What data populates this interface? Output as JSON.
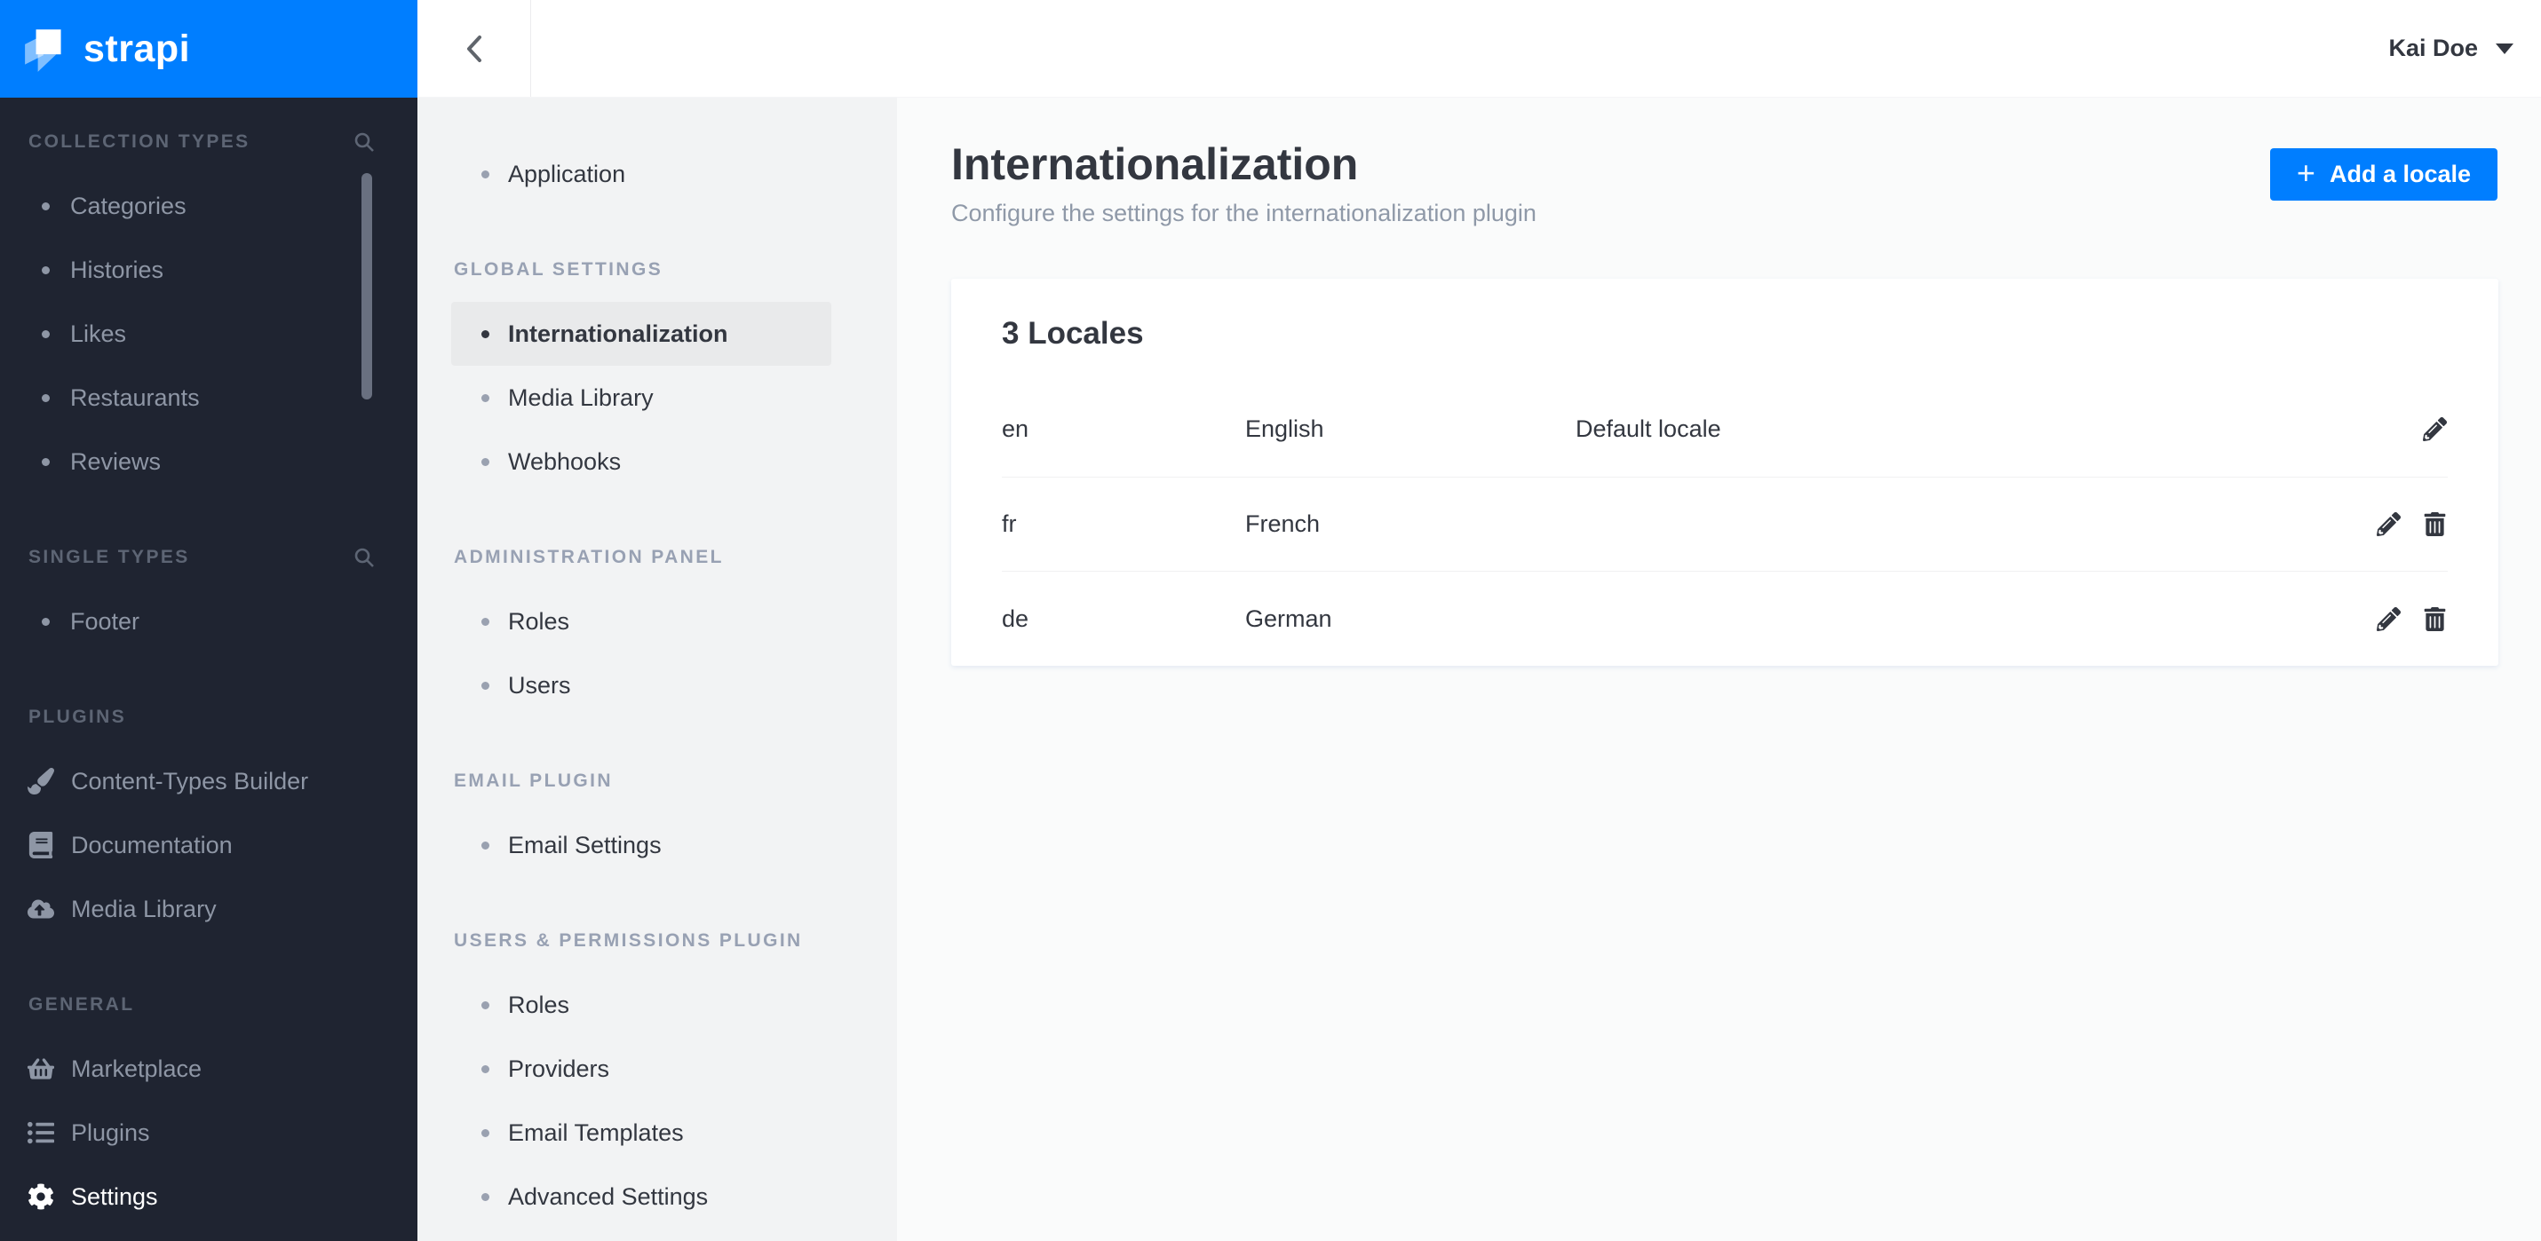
{
  "brand": {
    "name": "strapi",
    "header_color": "#007eff"
  },
  "topbar": {
    "back_icon": "chevron-left-icon",
    "user": {
      "name": "Kai Doe",
      "menu_icon": "caret-down-icon"
    }
  },
  "sidebar": {
    "sections": [
      {
        "title": "COLLECTION TYPES",
        "search_icon": "search-icon",
        "items": [
          {
            "label": "Categories",
            "icon": "bullet-dot"
          },
          {
            "label": "Histories",
            "icon": "bullet-dot"
          },
          {
            "label": "Likes",
            "icon": "bullet-dot"
          },
          {
            "label": "Restaurants",
            "icon": "bullet-dot"
          },
          {
            "label": "Reviews",
            "icon": "bullet-dot"
          }
        ]
      },
      {
        "title": "SINGLE TYPES",
        "search_icon": "search-icon",
        "items": [
          {
            "label": "Footer",
            "icon": "bullet-dot"
          }
        ]
      },
      {
        "title": "PLUGINS",
        "items": [
          {
            "label": "Content-Types Builder",
            "icon": "paint-brush-icon"
          },
          {
            "label": "Documentation",
            "icon": "book-icon"
          },
          {
            "label": "Media Library",
            "icon": "cloud-upload-icon"
          }
        ]
      },
      {
        "title": "GENERAL",
        "items": [
          {
            "label": "Marketplace",
            "icon": "shopping-basket-icon"
          },
          {
            "label": "Plugins",
            "icon": "list-icon"
          },
          {
            "label": "Settings",
            "icon": "gear-icon",
            "active": true
          }
        ]
      }
    ]
  },
  "settings_nav": {
    "top_item": {
      "label": "Application"
    },
    "sections": [
      {
        "title": "GLOBAL SETTINGS",
        "items": [
          {
            "label": "Internationalization",
            "active": true
          },
          {
            "label": "Media Library"
          },
          {
            "label": "Webhooks"
          }
        ]
      },
      {
        "title": "ADMINISTRATION PANEL",
        "items": [
          {
            "label": "Roles"
          },
          {
            "label": "Users"
          }
        ]
      },
      {
        "title": "EMAIL PLUGIN",
        "items": [
          {
            "label": "Email Settings"
          }
        ]
      },
      {
        "title": "USERS & PERMISSIONS PLUGIN",
        "items": [
          {
            "label": "Roles"
          },
          {
            "label": "Providers"
          },
          {
            "label": "Email Templates"
          },
          {
            "label": "Advanced Settings"
          }
        ]
      }
    ]
  },
  "page": {
    "title": "Internationalization",
    "subtitle": "Configure the settings for the internationalization plugin",
    "add_button": {
      "label": "Add a locale",
      "icon": "plus-icon",
      "color": "#007eff"
    },
    "locales_table": {
      "title": "3 Locales",
      "rows": [
        {
          "code": "en",
          "name": "English",
          "note": "Default locale",
          "actions": [
            "edit"
          ]
        },
        {
          "code": "fr",
          "name": "French",
          "note": "",
          "actions": [
            "edit",
            "delete"
          ]
        },
        {
          "code": "de",
          "name": "German",
          "note": "",
          "actions": [
            "edit",
            "delete"
          ]
        }
      ]
    }
  },
  "colors": {
    "accent_blue": "#007eff",
    "sidebar_bg": "#1f2431",
    "sidebar_text": "#8e96a5",
    "panel_bg": "#f2f3f4",
    "panel_selected_bg": "#e9eaeb",
    "main_bg": "#fafbfb",
    "text_dark": "#333740",
    "text_muted": "#8f99a8",
    "divider": "#f1f1f2"
  }
}
